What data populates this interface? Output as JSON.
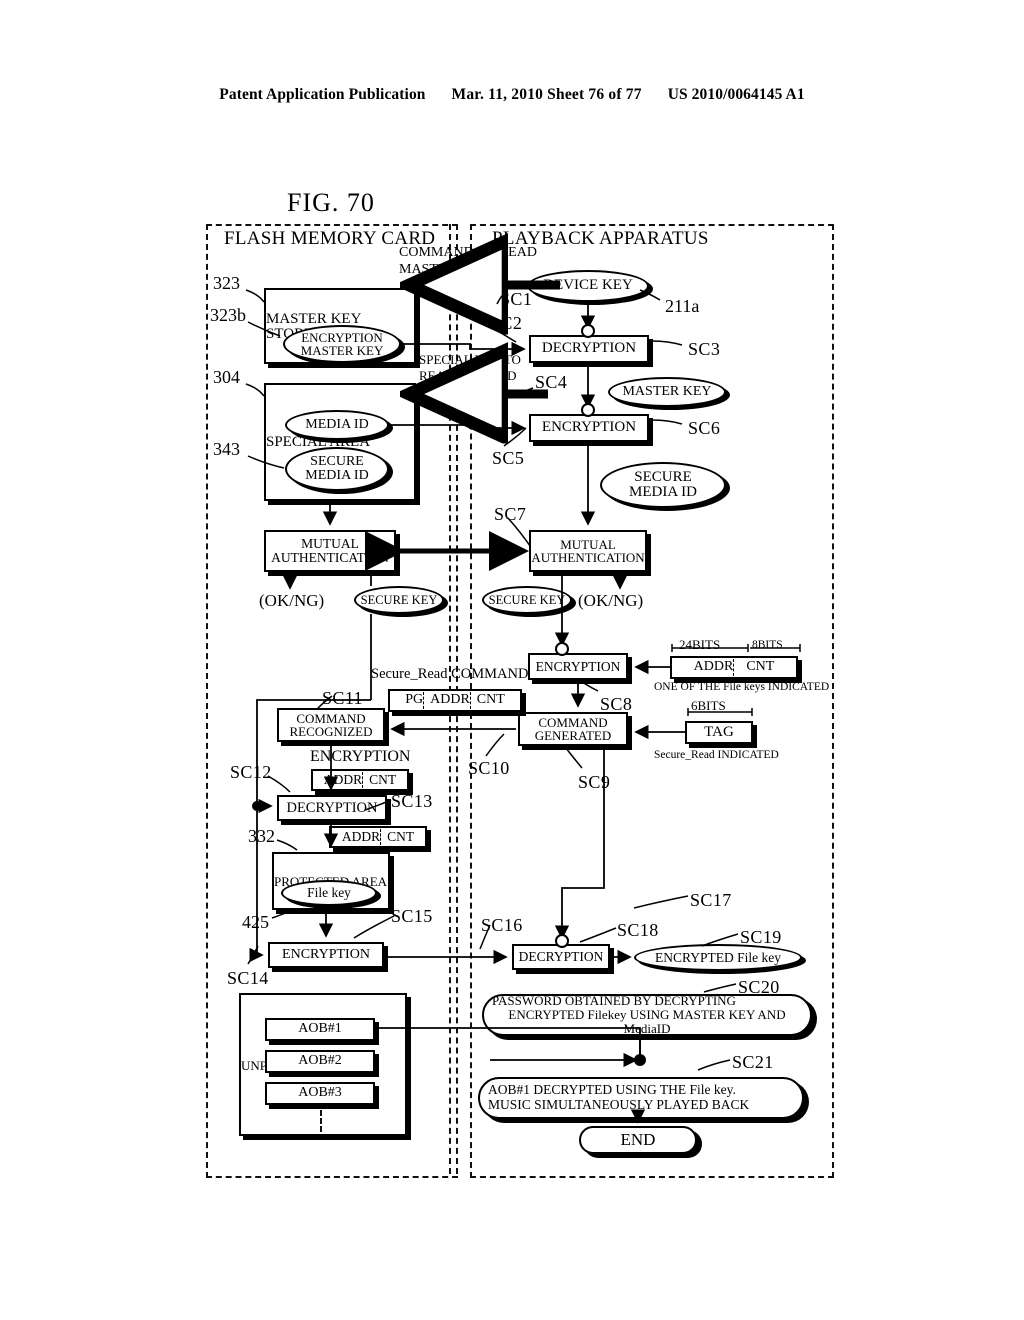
{
  "header": {
    "left": "Patent Application Publication",
    "date_sheet": "Mar. 11, 2010  Sheet 76 of 77",
    "pub_number": "US 2010/0064145 A1"
  },
  "figure": {
    "title": "FIG. 70",
    "panels": {
      "card": "FLASH MEMORY CARD",
      "player": "PLAYBACK APPARATUS"
    },
    "card_side": {
      "master_key_storing_unit": "MASTER KEY\nSTORING UNIT",
      "master_key_storing_unit_l1": "MASTER KEY",
      "master_key_storing_unit_l2": "STORING UNIT",
      "encryption_master_key_l1": "ENCRYPTION",
      "encryption_master_key_l2": "MASTER KEY",
      "special_area": "SPECIAL AREA",
      "media_id": "MEDIA ID",
      "secure_media_id_l1": "SECURE",
      "secure_media_id_l2": "MEDIA ID",
      "mutual_auth_l1": "MUTUAL",
      "mutual_auth_l2": "AUTHENTICATION",
      "ok_ng": "(OK/NG)",
      "secure_key": "SECURE KEY",
      "command_recognized_l1": "COMMAND",
      "command_recognized_l2": "RECOGNIZED",
      "encryption_label": "ENCRYPTION",
      "addr_cnt_1": "ADDR",
      "addr_cnt_1b": "CNT",
      "decryption": "DECRYPTION",
      "addr_cnt_2": "ADDR",
      "addr_cnt_2b": "CNT",
      "protected_area": "PROTECTED AREA",
      "file_key": "File key",
      "encryption_file_key": "ENCRYPTION",
      "unprotected_area": "UNPROTECTED AREA",
      "aob1": "AOB#1",
      "aob2": "AOB#2",
      "aob3": "AOB#3"
    },
    "player_side": {
      "device_key": "DEVICE KEY",
      "decryption_1": "DECRYPTION",
      "master_key": "MASTER KEY",
      "encryption_1": "ENCRYPTION",
      "secure_media_id_l1": "SECURE",
      "secure_media_id_l2": "MEDIA ID",
      "mutual_auth_l1": "MUTUAL",
      "mutual_auth_l2": "AUTHENTICATION",
      "ok_ng": "(OK/NG)",
      "secure_key": "SECURE KEY",
      "encryption_2": "ENCRYPTION",
      "command_generated_l1": "COMMAND",
      "command_generated_l2": "GENERATED",
      "addr": "ADDR",
      "cnt": "CNT",
      "bits_24": "24BITS",
      "bits_8": "8BITS",
      "bits_6": "6BITS",
      "one_of_file_keys": "ONE OF THE File keys INDICATED",
      "tag": "TAG",
      "secure_read_indicated": "Secure_Read INDICATED",
      "decryption_2": "DECRYPTION",
      "encrypted_file_key": "ENCRYPTED File key",
      "password_note_l1": "PASSWORD OBTAINED BY DECRYPTING",
      "password_note_l2": "ENCRYPTED Filekey USING MASTER KEY AND MediaID",
      "aob_note_l1": "AOB#1 DECRYPTED USING THE File key.",
      "aob_note_l2": "MUSIC SIMULTANEOUSLY PLAYED BACK",
      "end": "END"
    },
    "arrow_labels": {
      "cmd_read_master_key_l1": "COMMAND TO READ",
      "cmd_read_master_key_l2": "MASTER KEY",
      "special_key_l1": "SPECIAL KEY TO",
      "special_key_l2": "READ MEDIA ID",
      "secure_read_command": "Secure_Read COMMAND",
      "pg": "PG",
      "addr": "ADDR",
      "cnt": "CNT"
    },
    "reference_numerals": {
      "n323": "323",
      "n323b": "323b",
      "n304": "304",
      "n343": "343",
      "n211a": "211a",
      "n332": "332",
      "n425": "425"
    },
    "step_labels": {
      "sc1": "SC1",
      "sc2": "SC2",
      "sc3": "SC3",
      "sc4": "SC4",
      "sc5": "SC5",
      "sc6": "SC6",
      "sc7": "SC7",
      "sc8": "SC8",
      "sc9": "SC9",
      "sc10": "SC10",
      "sc11": "SC11",
      "sc12": "SC12",
      "sc13": "SC13",
      "sc14": "SC14",
      "sc15": "SC15",
      "sc16": "SC16",
      "sc17": "SC17",
      "sc18": "SC18",
      "sc19": "SC19",
      "sc20": "SC20",
      "sc21": "SC21"
    }
  }
}
